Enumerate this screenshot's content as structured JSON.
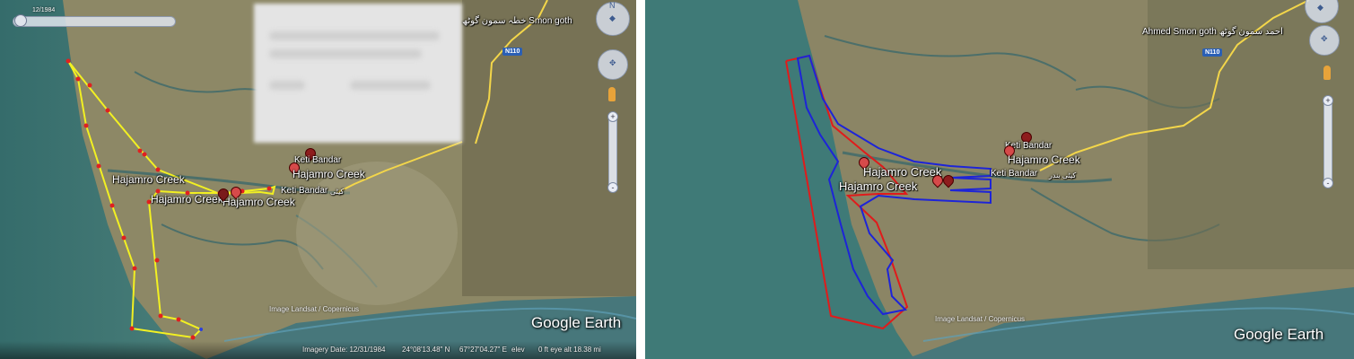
{
  "left_panel": {
    "timeslider": {
      "date": "12/1984"
    },
    "labels": {
      "smon_goth": "خطہ سمون گوٹھ Smon goth",
      "road": "N110",
      "keti_bandar_top": "Keti Bandar",
      "hajamro_creek_1": "Hajamro Creek",
      "hajamro_creek_2": "Hajamro Creek",
      "hajamro_creek_3": "Hajamro Creek",
      "hajamro_creek_4": "Hajamro Creek",
      "keti_bandar_2": "Keti Bandar",
      "keti_urdu": "کیٹی",
      "image_credit": "Image Landsat / Copernicus",
      "watermark": "Google Earth"
    },
    "status": {
      "imagery_date": "Imagery Date: 12/31/1984",
      "lat": "24°08'13.48\" N",
      "lon": "67°27'04.27\" E",
      "elev": "elev",
      "eye_alt": "0 ft   eye alt  18.38 mi"
    }
  },
  "right_panel": {
    "labels": {
      "ahmed_smon_goth": "Ahmed Smon goth احمد سمون گوٹھ",
      "road": "N110",
      "keti_bandar_1": "Keti Bandar",
      "hajamro_creek_1": "Hajamro Creek",
      "hajamro_creek_2": "Hajamro Creek",
      "hajamro_creek_3": "Hajamro Creek",
      "keti_bandar_2": "Keti Bandar",
      "keti_urdu": "کیٹی بندر",
      "image_credit": "Image Landsat / Copernicus",
      "watermark": "Google Earth"
    }
  },
  "controls": {
    "nav_compass_icon": "compass-icon",
    "look_icon": "look-around-icon",
    "pegman_icon": "pegman-icon",
    "zoom_in": "+",
    "zoom_out": "-",
    "north": "N"
  },
  "colors": {
    "sea": "#3f7a77",
    "land": "#8a8562",
    "yellow_outline": "#f2f022",
    "red_points": "#e02020",
    "blue_outline": "#1d24d8",
    "red_outline": "#e01b1b",
    "road": "#f3d64a"
  }
}
